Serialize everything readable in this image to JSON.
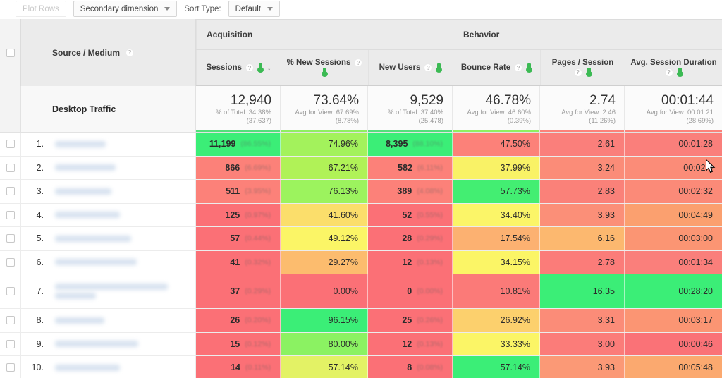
{
  "toolbar": {
    "plot_rows_label": "Plot Rows",
    "secondary_dimension_label": "Secondary dimension",
    "sort_type_label": "Sort Type:",
    "sort_type_value": "Default"
  },
  "table": {
    "dimension_header": "Source / Medium",
    "groups": [
      {
        "label": "Acquisition"
      },
      {
        "label": "Behavior"
      }
    ],
    "columns": [
      {
        "label": "Sessions",
        "sorted": true
      },
      {
        "label": "% New Sessions",
        "sorted": false
      },
      {
        "label": "New Users",
        "sorted": false
      },
      {
        "label": "Bounce Rate",
        "sorted": false
      },
      {
        "label": "Pages / Session",
        "sorted": false
      },
      {
        "label": "Avg. Session Duration",
        "sorted": false
      }
    ],
    "summary": {
      "label": "Desktop Traffic",
      "cells": [
        {
          "value": "12,940",
          "note1": "% of Total: 34.38%",
          "note2": "(37,637)",
          "bar": "#52e07a"
        },
        {
          "value": "73.64%",
          "note1": "Avg for View: 67.69%",
          "note2": "(8.78%)",
          "bar": "#8ef060"
        },
        {
          "value": "9,529",
          "note1": "% of Total: 37.40%",
          "note2": "(25,478)",
          "bar": "#52e07a"
        },
        {
          "value": "46.78%",
          "note1": "Avg for View: 46.60%",
          "note2": "(0.39%)",
          "bar": "#8ef060"
        },
        {
          "value": "2.74",
          "note1": "Avg for View: 2.46",
          "note2": "(11.26%)",
          "bar": "#fc8179"
        },
        {
          "value": "00:01:44",
          "note1": "Avg for View: 00:01:21",
          "note2": "(28.69%)",
          "bar": "#fc8179"
        }
      ]
    },
    "rows": [
      {
        "index": "1.",
        "tall": false,
        "sessions": "11,199",
        "sessions_pct": "(86.55%)",
        "sessions_bg": "#3bee77",
        "new_sessions": "74.96%",
        "new_sessions_bg": "#a3f25c",
        "new_users": "8,395",
        "new_users_pct": "(88.10%)",
        "new_users_bg": "#3bee77",
        "bounce": "47.50%",
        "bounce_bg": "#fc8179",
        "pages": "2.61",
        "pages_bg": "#fa7f7b",
        "duration": "00:01:28",
        "duration_bg": "#fa7f7b"
      },
      {
        "index": "2.",
        "tall": false,
        "sessions": "866",
        "sessions_pct": "(6.69%)",
        "sessions_bg": "#fc8179",
        "new_sessions": "67.21%",
        "new_sessions_bg": "#b0f257",
        "new_users": "582",
        "new_users_pct": "(6.11%)",
        "new_users_bg": "#fc8179",
        "bounce": "37.99%",
        "bounce_bg": "#f9f266",
        "pages": "3.24",
        "pages_bg": "#fb8c78",
        "duration": "00:02:5",
        "duration_bg": "#fb8c78"
      },
      {
        "index": "3.",
        "tall": false,
        "sessions": "511",
        "sessions_pct": "(3.95%)",
        "sessions_bg": "#fc8179",
        "new_sessions": "76.13%",
        "new_sessions_bg": "#9cf35e",
        "new_users": "389",
        "new_users_pct": "(4.08%)",
        "new_users_bg": "#fc8179",
        "bounce": "57.73%",
        "bounce_bg": "#43ee72",
        "pages": "2.83",
        "pages_bg": "#fa8179",
        "duration": "00:02:32",
        "duration_bg": "#fb8a78"
      },
      {
        "index": "4.",
        "tall": false,
        "sessions": "125",
        "sessions_pct": "(0.97%)",
        "sessions_bg": "#fb7076",
        "new_sessions": "41.60%",
        "new_sessions_bg": "#fbde6b",
        "new_users": "52",
        "new_users_pct": "(0.55%)",
        "new_users_bg": "#fb7076",
        "bounce": "34.40%",
        "bounce_bg": "#fbf568",
        "pages": "3.93",
        "pages_bg": "#fb8f78",
        "duration": "00:04:49",
        "duration_bg": "#fba06f"
      },
      {
        "index": "5.",
        "tall": false,
        "sessions": "57",
        "sessions_pct": "(0.44%)",
        "sessions_bg": "#fb7076",
        "new_sessions": "49.12%",
        "new_sessions_bg": "#fbf566",
        "new_users": "28",
        "new_users_pct": "(0.29%)",
        "new_users_bg": "#fb7076",
        "bounce": "17.54%",
        "bounce_bg": "#fcb171",
        "pages": "6.16",
        "pages_bg": "#fcb86f",
        "duration": "00:03:00",
        "duration_bg": "#fb9573"
      },
      {
        "index": "6.",
        "tall": false,
        "sessions": "41",
        "sessions_pct": "(0.32%)",
        "sessions_bg": "#fb7076",
        "new_sessions": "29.27%",
        "new_sessions_bg": "#fcbc6e",
        "new_users": "12",
        "new_users_pct": "(0.13%)",
        "new_users_bg": "#fb7076",
        "bounce": "34.15%",
        "bounce_bg": "#fbf566",
        "pages": "2.78",
        "pages_bg": "#fb7c79",
        "duration": "00:01:34",
        "duration_bg": "#fa7f7b"
      },
      {
        "index": "7.",
        "tall": true,
        "sessions": "37",
        "sessions_pct": "(0.29%)",
        "sessions_bg": "#fb7076",
        "new_sessions": "0.00%",
        "new_sessions_bg": "#fb7076",
        "new_users": "0",
        "new_users_pct": "(0.00%)",
        "new_users_bg": "#fb7076",
        "bounce": "10.81%",
        "bounce_bg": "#fb7a78",
        "pages": "16.35",
        "pages_bg": "#3bee77",
        "duration": "00:28:20",
        "duration_bg": "#3bee77"
      },
      {
        "index": "8.",
        "tall": false,
        "sessions": "26",
        "sessions_pct": "(0.20%)",
        "sessions_bg": "#fb7076",
        "new_sessions": "96.15%",
        "new_sessions_bg": "#3bee77",
        "new_users": "25",
        "new_users_pct": "(0.26%)",
        "new_users_bg": "#fb7076",
        "bounce": "26.92%",
        "bounce_bg": "#fcd06d",
        "pages": "3.31",
        "pages_bg": "#fb8c78",
        "duration": "00:03:17",
        "duration_bg": "#fb9573"
      },
      {
        "index": "9.",
        "tall": false,
        "sessions": "15",
        "sessions_pct": "(0.12%)",
        "sessions_bg": "#fb7076",
        "new_sessions": "80.00%",
        "new_sessions_bg": "#8bf262",
        "new_users": "12",
        "new_users_pct": "(0.13%)",
        "new_users_bg": "#fb7076",
        "bounce": "33.33%",
        "bounce_bg": "#fbf566",
        "pages": "3.00",
        "pages_bg": "#fb7c79",
        "duration": "00:00:46",
        "duration_bg": "#fa7277"
      },
      {
        "index": "10.",
        "tall": false,
        "sessions": "14",
        "sessions_pct": "(0.11%)",
        "sessions_bg": "#fb7076",
        "new_sessions": "57.14%",
        "new_sessions_bg": "#e3f265",
        "new_users": "8",
        "new_users_pct": "(0.08%)",
        "new_users_bg": "#fb7076",
        "bounce": "57.14%",
        "bounce_bg": "#3bee77",
        "pages": "3.93",
        "pages_bg": "#fb9976",
        "duration": "00:05:48",
        "duration_bg": "#fba96f"
      }
    ]
  },
  "colors": {
    "good": "#3bee77",
    "bad": "#fb7076",
    "mid": "#fbf566",
    "header_bg": "#ebebeb",
    "accent_green": "#3cba54"
  }
}
